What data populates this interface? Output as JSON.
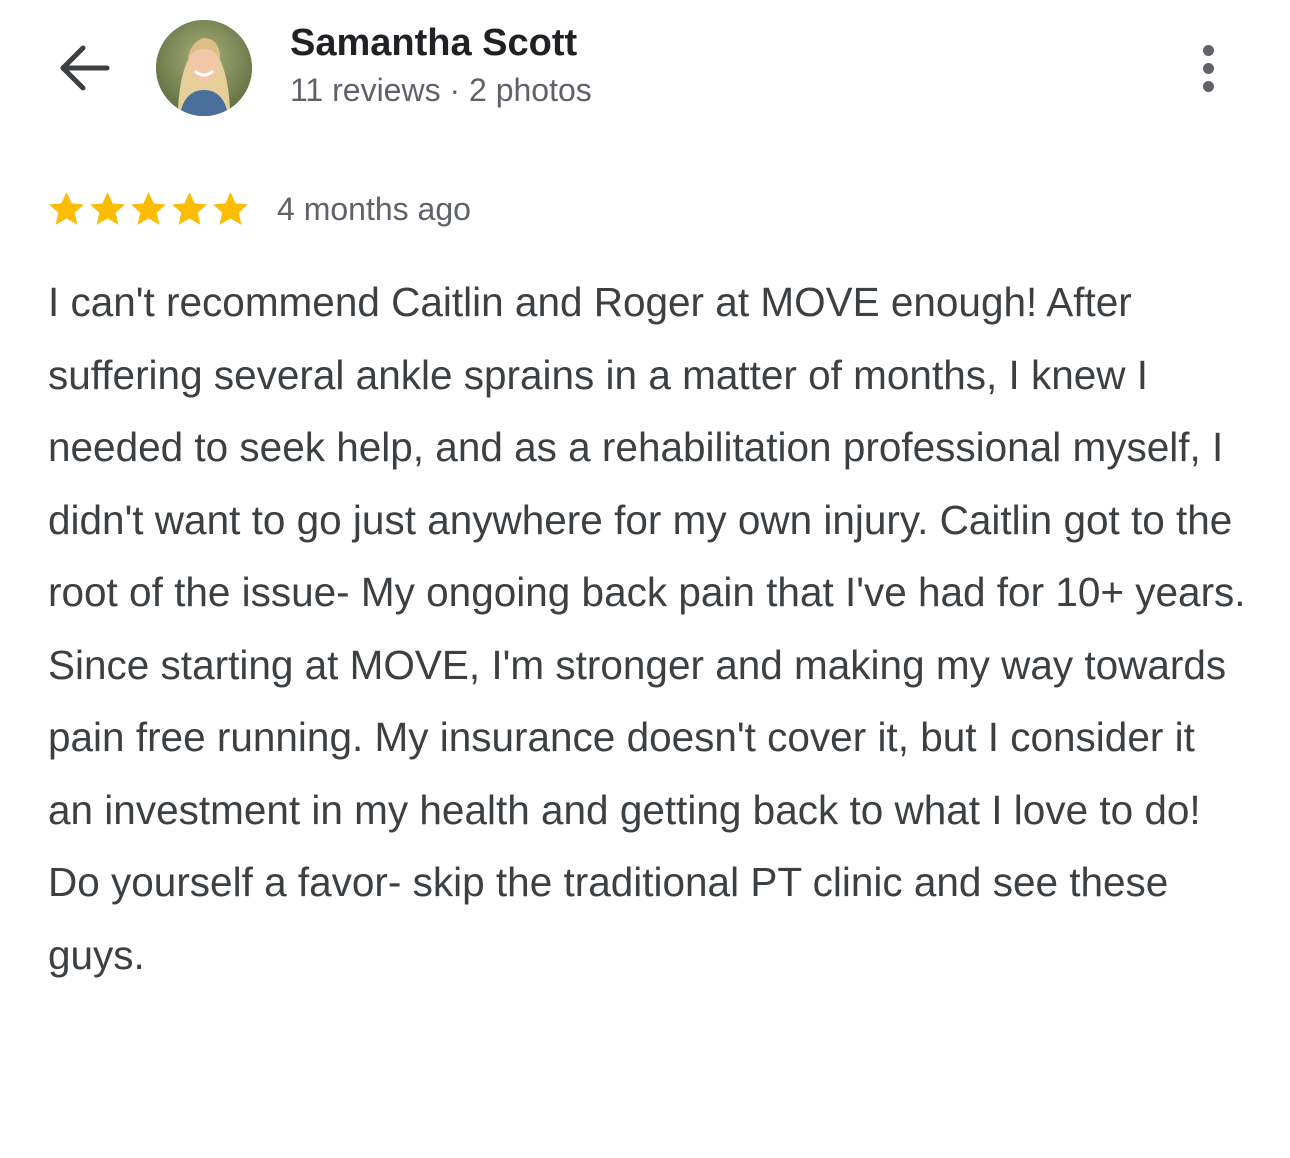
{
  "reviewer": {
    "name": "Samantha Scott",
    "meta": "11 reviews · 2 photos",
    "avatar_icon": "profile-photo"
  },
  "header": {
    "back_icon": "arrow-left-icon",
    "more_icon": "more-vertical-icon"
  },
  "review": {
    "rating": 5,
    "rating_max": 5,
    "star_color": "#fbbc04",
    "time_ago": "4 months ago",
    "text": "I can't recommend Caitlin and Roger at MOVE enough! After suffering several ankle sprains in a matter of months, I knew I needed to seek help, and as a rehabilitation professional myself, I didn't want to go just anywhere for my own injury. Caitlin got to the root of the issue- My ongoing back pain that I've had for 10+ years. Since starting at MOVE, I'm stronger and making my way towards pain free running. My insurance doesn't cover it, but I consider it an investment in my health and getting back to what I love to do! Do yourself a favor- skip the traditional PT clinic and see these guys."
  }
}
